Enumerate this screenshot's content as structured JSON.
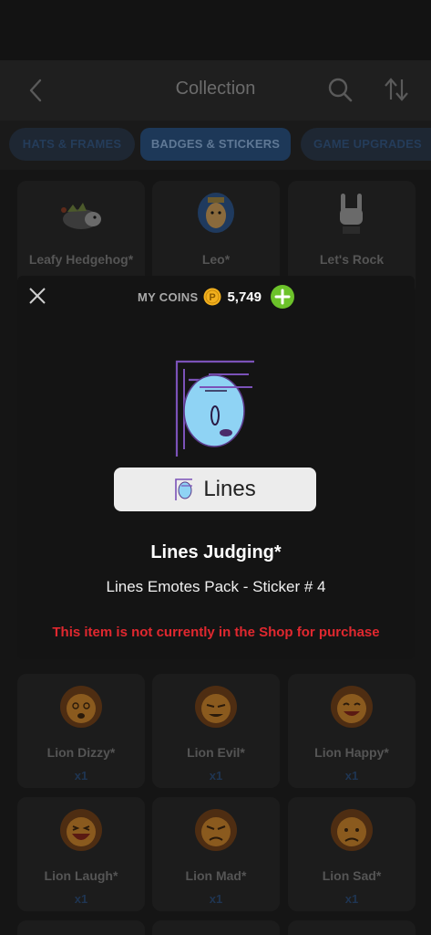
{
  "header": {
    "title": "Collection",
    "back_icon": "chevron-left-icon",
    "search_icon": "search-icon",
    "sort_icon": "sort-icon"
  },
  "tabs": [
    {
      "label": "HATS & FRAMES"
    },
    {
      "label": "BADGES & STICKERS",
      "selected": true
    },
    {
      "label": "GAME UPGRADES"
    }
  ],
  "grid": [
    {
      "name": "Leafy Hedgehog*",
      "qty": ""
    },
    {
      "name": "Leo*",
      "qty": ""
    },
    {
      "name": "Let's Rock",
      "qty": ""
    },
    {
      "name": "Lion Dizzy*",
      "qty": "x1"
    },
    {
      "name": "Lion Evil*",
      "qty": "x1"
    },
    {
      "name": "Lion Happy*",
      "qty": "x1"
    },
    {
      "name": "Lion Laugh*",
      "qty": "x1"
    },
    {
      "name": "Lion Mad*",
      "qty": "x1"
    },
    {
      "name": "Lion Sad*",
      "qty": "x1"
    }
  ],
  "modal": {
    "coins_label": "MY COINS",
    "coins_value": "5,749",
    "plate_text": "Lines",
    "item_title": "Lines Judging*",
    "item_subtitle": "Lines Emotes Pack - Sticker # 4",
    "warning": "This item is not currently in the Shop for purchase"
  },
  "colors": {
    "accent_blue": "#1d3858",
    "coin_gold": "#f2b01e",
    "add_green": "#6cc22a",
    "warning_red": "#e0282f",
    "sticker_face": "#8fd3f4"
  }
}
